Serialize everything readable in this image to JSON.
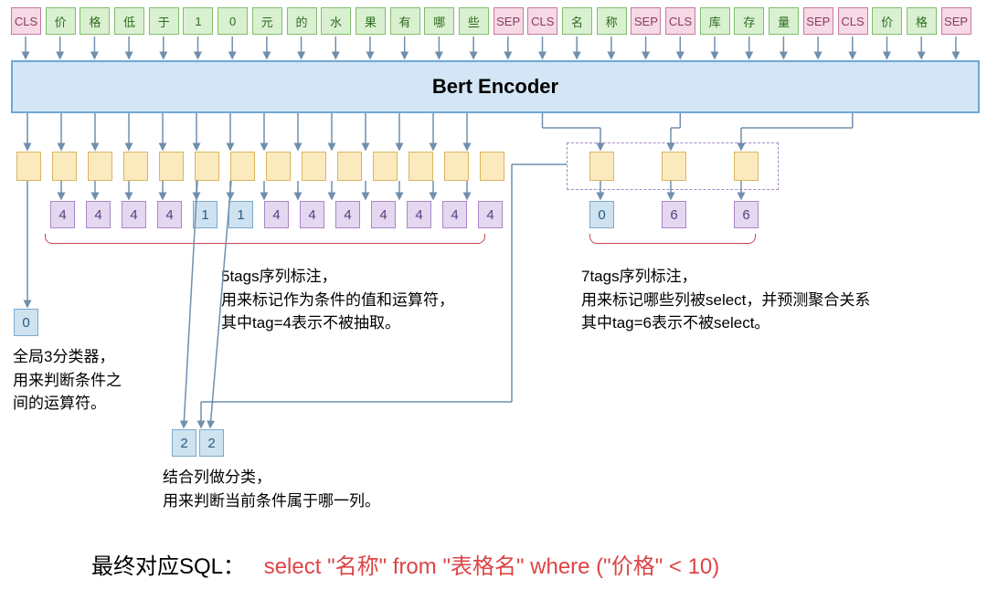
{
  "tokens": {
    "row1": [
      {
        "t": "CLS",
        "c": "cls"
      },
      {
        "t": "价",
        "c": "chr"
      },
      {
        "t": "格",
        "c": "chr"
      },
      {
        "t": "低",
        "c": "chr"
      },
      {
        "t": "于",
        "c": "chr"
      },
      {
        "t": "1",
        "c": "chr"
      },
      {
        "t": "0",
        "c": "chr"
      },
      {
        "t": "元",
        "c": "chr"
      },
      {
        "t": "的",
        "c": "chr"
      },
      {
        "t": "水",
        "c": "chr"
      },
      {
        "t": "果",
        "c": "chr"
      },
      {
        "t": "有",
        "c": "chr"
      },
      {
        "t": "哪",
        "c": "chr"
      },
      {
        "t": "些",
        "c": "chr"
      },
      {
        "t": "SEP",
        "c": "sep"
      },
      {
        "t": "CLS",
        "c": "cls"
      },
      {
        "t": "名",
        "c": "chr"
      },
      {
        "t": "称",
        "c": "chr"
      },
      {
        "t": "SEP",
        "c": "sep"
      },
      {
        "t": "CLS",
        "c": "cls"
      },
      {
        "t": "库",
        "c": "chr"
      },
      {
        "t": "存",
        "c": "chr"
      },
      {
        "t": "量",
        "c": "chr"
      },
      {
        "t": "SEP",
        "c": "sep"
      },
      {
        "t": "CLS",
        "c": "cls"
      },
      {
        "t": "价",
        "c": "chr"
      },
      {
        "t": "格",
        "c": "chr"
      },
      {
        "t": "SEP",
        "c": "sep"
      }
    ]
  },
  "encoder": "Bert Encoder",
  "tags5": [
    "4",
    "4",
    "4",
    "4",
    "1",
    "1",
    "4",
    "4",
    "4",
    "4",
    "4",
    "4",
    "4"
  ],
  "tags5_style": [
    "P",
    "P",
    "P",
    "P",
    "B",
    "B",
    "P",
    "P",
    "P",
    "P",
    "P",
    "P",
    "P"
  ],
  "tags7": [
    "0",
    "6",
    "6"
  ],
  "tags7_style": [
    "B",
    "P",
    "P"
  ],
  "global": {
    "val": "0"
  },
  "col": {
    "vals": [
      "2",
      "2"
    ]
  },
  "d1": {
    "l1": "全局3分类器，",
    "l2": "用来判断条件之",
    "l3": "间的运算符。"
  },
  "d2": {
    "l1": "5tags序列标注，",
    "l2": "用来标记作为条件的值和运算符，",
    "l3": "其中tag=4表示不被抽取。"
  },
  "d3": {
    "l1": "结合列做分类，",
    "l2": "用来判断当前条件属于哪一列。"
  },
  "d4": {
    "l1": "7tags序列标注，",
    "l2": "用来标记哪些列被select，并预测聚合关系",
    "l3": "其中tag=6表示不被select。"
  },
  "sql": {
    "label": "最终对应SQL：",
    "q": "select \"名称\" from \"表格名\" where (\"价格\" < 10)"
  }
}
